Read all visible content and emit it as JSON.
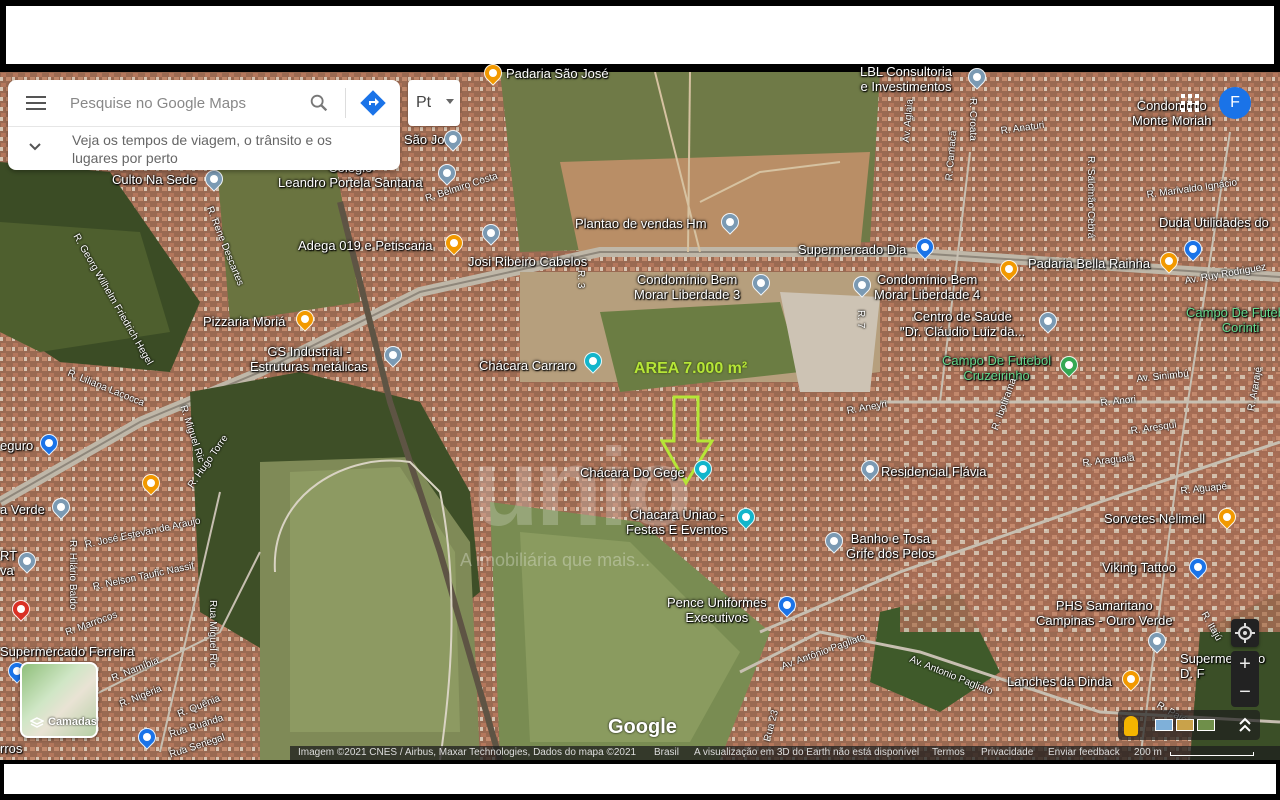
{
  "search": {
    "placeholder": "Pesquise no Google Maps",
    "hint": "Veja os tempos de viagem, o trânsito e os lugares por perto",
    "language_label": "Pt"
  },
  "account": {
    "avatar_letter": "F"
  },
  "overlay": {
    "area_label": "AREA 7.000 m²",
    "watermark": "unio",
    "watermark_sub": "A imobiliária que mais..."
  },
  "places": [
    {
      "id": "padaria-sao-jose",
      "label": "Padaria São José"
    },
    {
      "id": "lbl-consultoria",
      "label": "LBL Consultoria\ne Investimentos"
    },
    {
      "id": "condominio-monte-moriah",
      "label": "Condomínio\nMonte Moriah"
    },
    {
      "id": "colegio",
      "label": "Colégio\nLeandro Portela Santana"
    },
    {
      "id": "sao-jose",
      "label": "São José"
    },
    {
      "id": "culto-na-sede",
      "label": "Culto Na Sede"
    },
    {
      "id": "plantao-vendas",
      "label": "Plantao de vendas Hm"
    },
    {
      "id": "adega-019",
      "label": "Adega 019 e Petiscaria"
    },
    {
      "id": "josi-ribeiro",
      "label": "Josi Ribeiro Cabelos"
    },
    {
      "id": "supermercado-dia",
      "label": "Supermercado Dia"
    },
    {
      "id": "duda-utilidades",
      "label": "Duda Utilidades do"
    },
    {
      "id": "padaria-bella-rainha",
      "label": "Padaria Bella Rainha"
    },
    {
      "id": "bem-morar-3",
      "label": "Condomínio Bem\nMorar Liberdade 3"
    },
    {
      "id": "bem-morar-4",
      "label": "Condomínio Bem\nMorar Liberdade 4"
    },
    {
      "id": "centro-saude",
      "label": "Centro de Saúde\n\"Dr. Cláudio Luiz da..."
    },
    {
      "id": "campo-futebol-corinthians",
      "label": "Campo De Futebol\nCorinti"
    },
    {
      "id": "pizzaria-moria",
      "label": "Pizzaria Moriá"
    },
    {
      "id": "gs-industrial",
      "label": "GS Industrial -\nEstruturas metálicas"
    },
    {
      "id": "chacara-carraro",
      "label": "Chácara Carraro"
    },
    {
      "id": "campo-cruzeirinho",
      "label": "Campo De Futebol\nCruzeirinho"
    },
    {
      "id": "chacara-gege",
      "label": "Chácara Do Gege"
    },
    {
      "id": "residencial-flavia",
      "label": "Residencial Flávia"
    },
    {
      "id": "chacara-uniao",
      "label": "Chacara Uniao -\nFestas E Eventos"
    },
    {
      "id": "banho-tosa",
      "label": "Banho e Tosa\nGrife dos Pelos"
    },
    {
      "id": "sorvetes-nelimell",
      "label": "Sorvetes Nelimell"
    },
    {
      "id": "viking-tattoo",
      "label": "Viking Tattoo"
    },
    {
      "id": "pence-uniformes",
      "label": "Pence Uniformes\nExecutivos"
    },
    {
      "id": "phs-samaritano",
      "label": "PHS Samaritano\nCampinas - Ouro Verde"
    },
    {
      "id": "supermercado-ferreira",
      "label": "Supermercado Ferreira"
    },
    {
      "id": "lanches-dinda",
      "label": "Lanches da Dinda"
    },
    {
      "id": "supermercado-right",
      "label": "Supermercado\nD. F"
    },
    {
      "id": "seguro",
      "label": "eguro"
    },
    {
      "id": "a-verde",
      "label": "a Verde"
    },
    {
      "id": "rt-va",
      "label": "RT\nva"
    },
    {
      "id": "rros",
      "label": "rros"
    }
  ],
  "streets": [
    "R. Georg Wilhelm Friedrich Hegel",
    "R. Rene Descartes",
    "R. Belmiro Costa",
    "R. Liliana Lacocca",
    "R. Miguel Ric",
    "R. Hugo Torre",
    "R. José Estevan de Araujo",
    "R. Nelson Taufic Nassif",
    "R. Hilário Baldo",
    "R. Marrocos",
    "R. Namíbia",
    "R. Nigéria",
    "R. Quênia",
    "Rua Ruanda",
    "Rua Senegal",
    "Rua Miguel Ric",
    "R. Anaturi",
    "R. Croata",
    "Av. Aglaia",
    "R. Camacã",
    "R. Marivaldo Ignácio",
    "R. Salomão Cebrá",
    "Av. Ruy Rodriguez",
    "Av. Sinimbú",
    "R. Aneyri",
    "R. Anori",
    "R. Aresqui",
    "R. Araguaia",
    "R. Aguapé",
    "R. Itajú",
    "R. 7",
    "R. 3",
    "R. Ararajé",
    "Av. Antônio Pagliato",
    "Av. Antonio Pagliato",
    "Rua 23",
    "R. Pajé",
    "R. Italin",
    "Av. Anhu",
    "R. Ibotirama"
  ],
  "controls": {
    "layers_label": "Camadas",
    "zoom_in": "+",
    "zoom_out": "−"
  },
  "footer": {
    "imagery": "Imagem ©2021 CNES / Airbus, Maxar Technologies, Dados do mapa ©2021",
    "country": "Brasil",
    "earth_3d": "A visualização em 3D do Earth não está disponível",
    "terms": "Termos",
    "privacy": "Privacidade",
    "feedback": "Enviar feedback",
    "scale": "200 m"
  },
  "logo": "Google",
  "colors": {
    "accent": "#1a73e8",
    "area_label": "#b6e637",
    "pin_red": "#d93025",
    "pin_orange": "#f29900",
    "pin_blue": "#1a73e8",
    "pin_teal": "#12b5cb",
    "pin_grey": "#7b9ab3",
    "pin_green": "#34a853"
  }
}
